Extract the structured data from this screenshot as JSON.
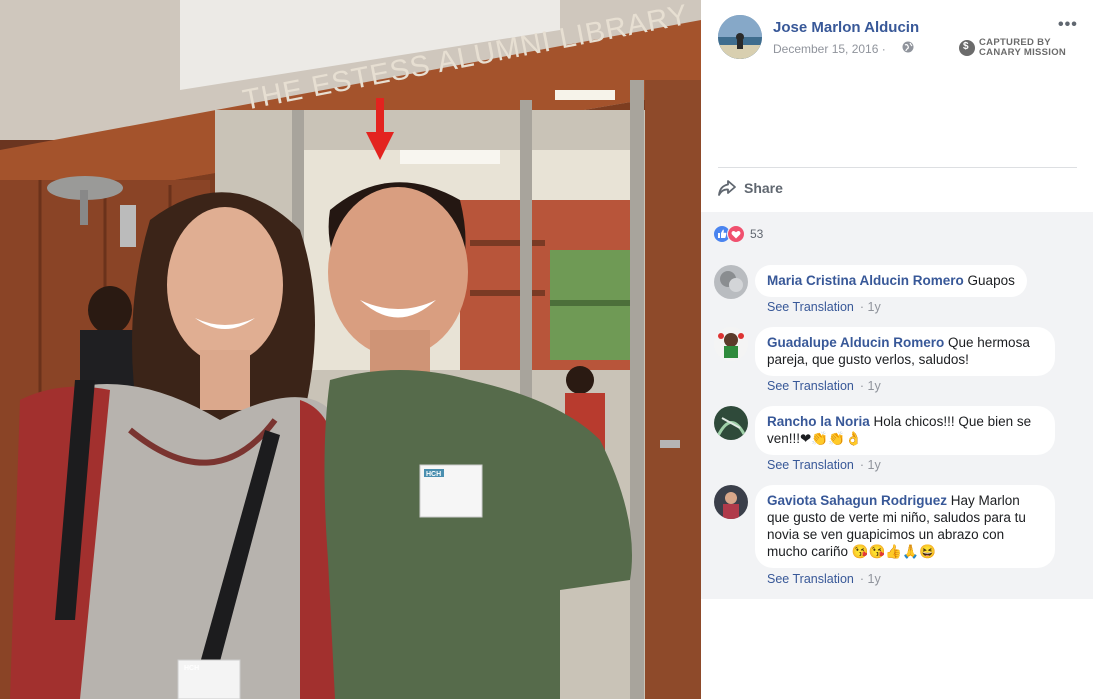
{
  "photo": {
    "sign_text": "THE ESTESS ALUMNI LIBRARY",
    "name_tag_text": "HCH"
  },
  "post": {
    "author": "Jose Marlon Alducin",
    "date": "December 15, 2016 ·",
    "privacy_icon": "globe-icon",
    "more_label": "•••",
    "watermark_line1": "CAPTURED BY",
    "watermark_line2": "CANARY MISSION",
    "share_label": "Share",
    "reaction_count": "53"
  },
  "comments": [
    {
      "name": "Maria Cristina Alducin Romero",
      "text": " Guapos",
      "translate": "See Translation",
      "time": "· 1y"
    },
    {
      "name": "Guadalupe Alducin Romero",
      "text": " Que hermosa pareja, que gusto verlos, saludos!",
      "translate": "See Translation",
      "time": "· 1y"
    },
    {
      "name": "Rancho la Noria",
      "text": " Hola chicos!!! Que bien se ven!!!❤👏👏👌",
      "translate": "See Translation",
      "time": "· 1y"
    },
    {
      "name": "Gaviota Sahagun Rodriguez",
      "text": " Hay Marlon que gusto de verte mi niño, saludos para tu novia se ven guapicimos un abrazo con mucho cariño 😘😘👍🙏😆",
      "translate": "See Translation",
      "time": "· 1y"
    }
  ],
  "colors": {
    "link_blue": "#385898",
    "meta_gray": "#90949c",
    "comments_bg": "#f2f3f5",
    "like_blue": "#4a84ef",
    "love_red": "#f0506e"
  }
}
